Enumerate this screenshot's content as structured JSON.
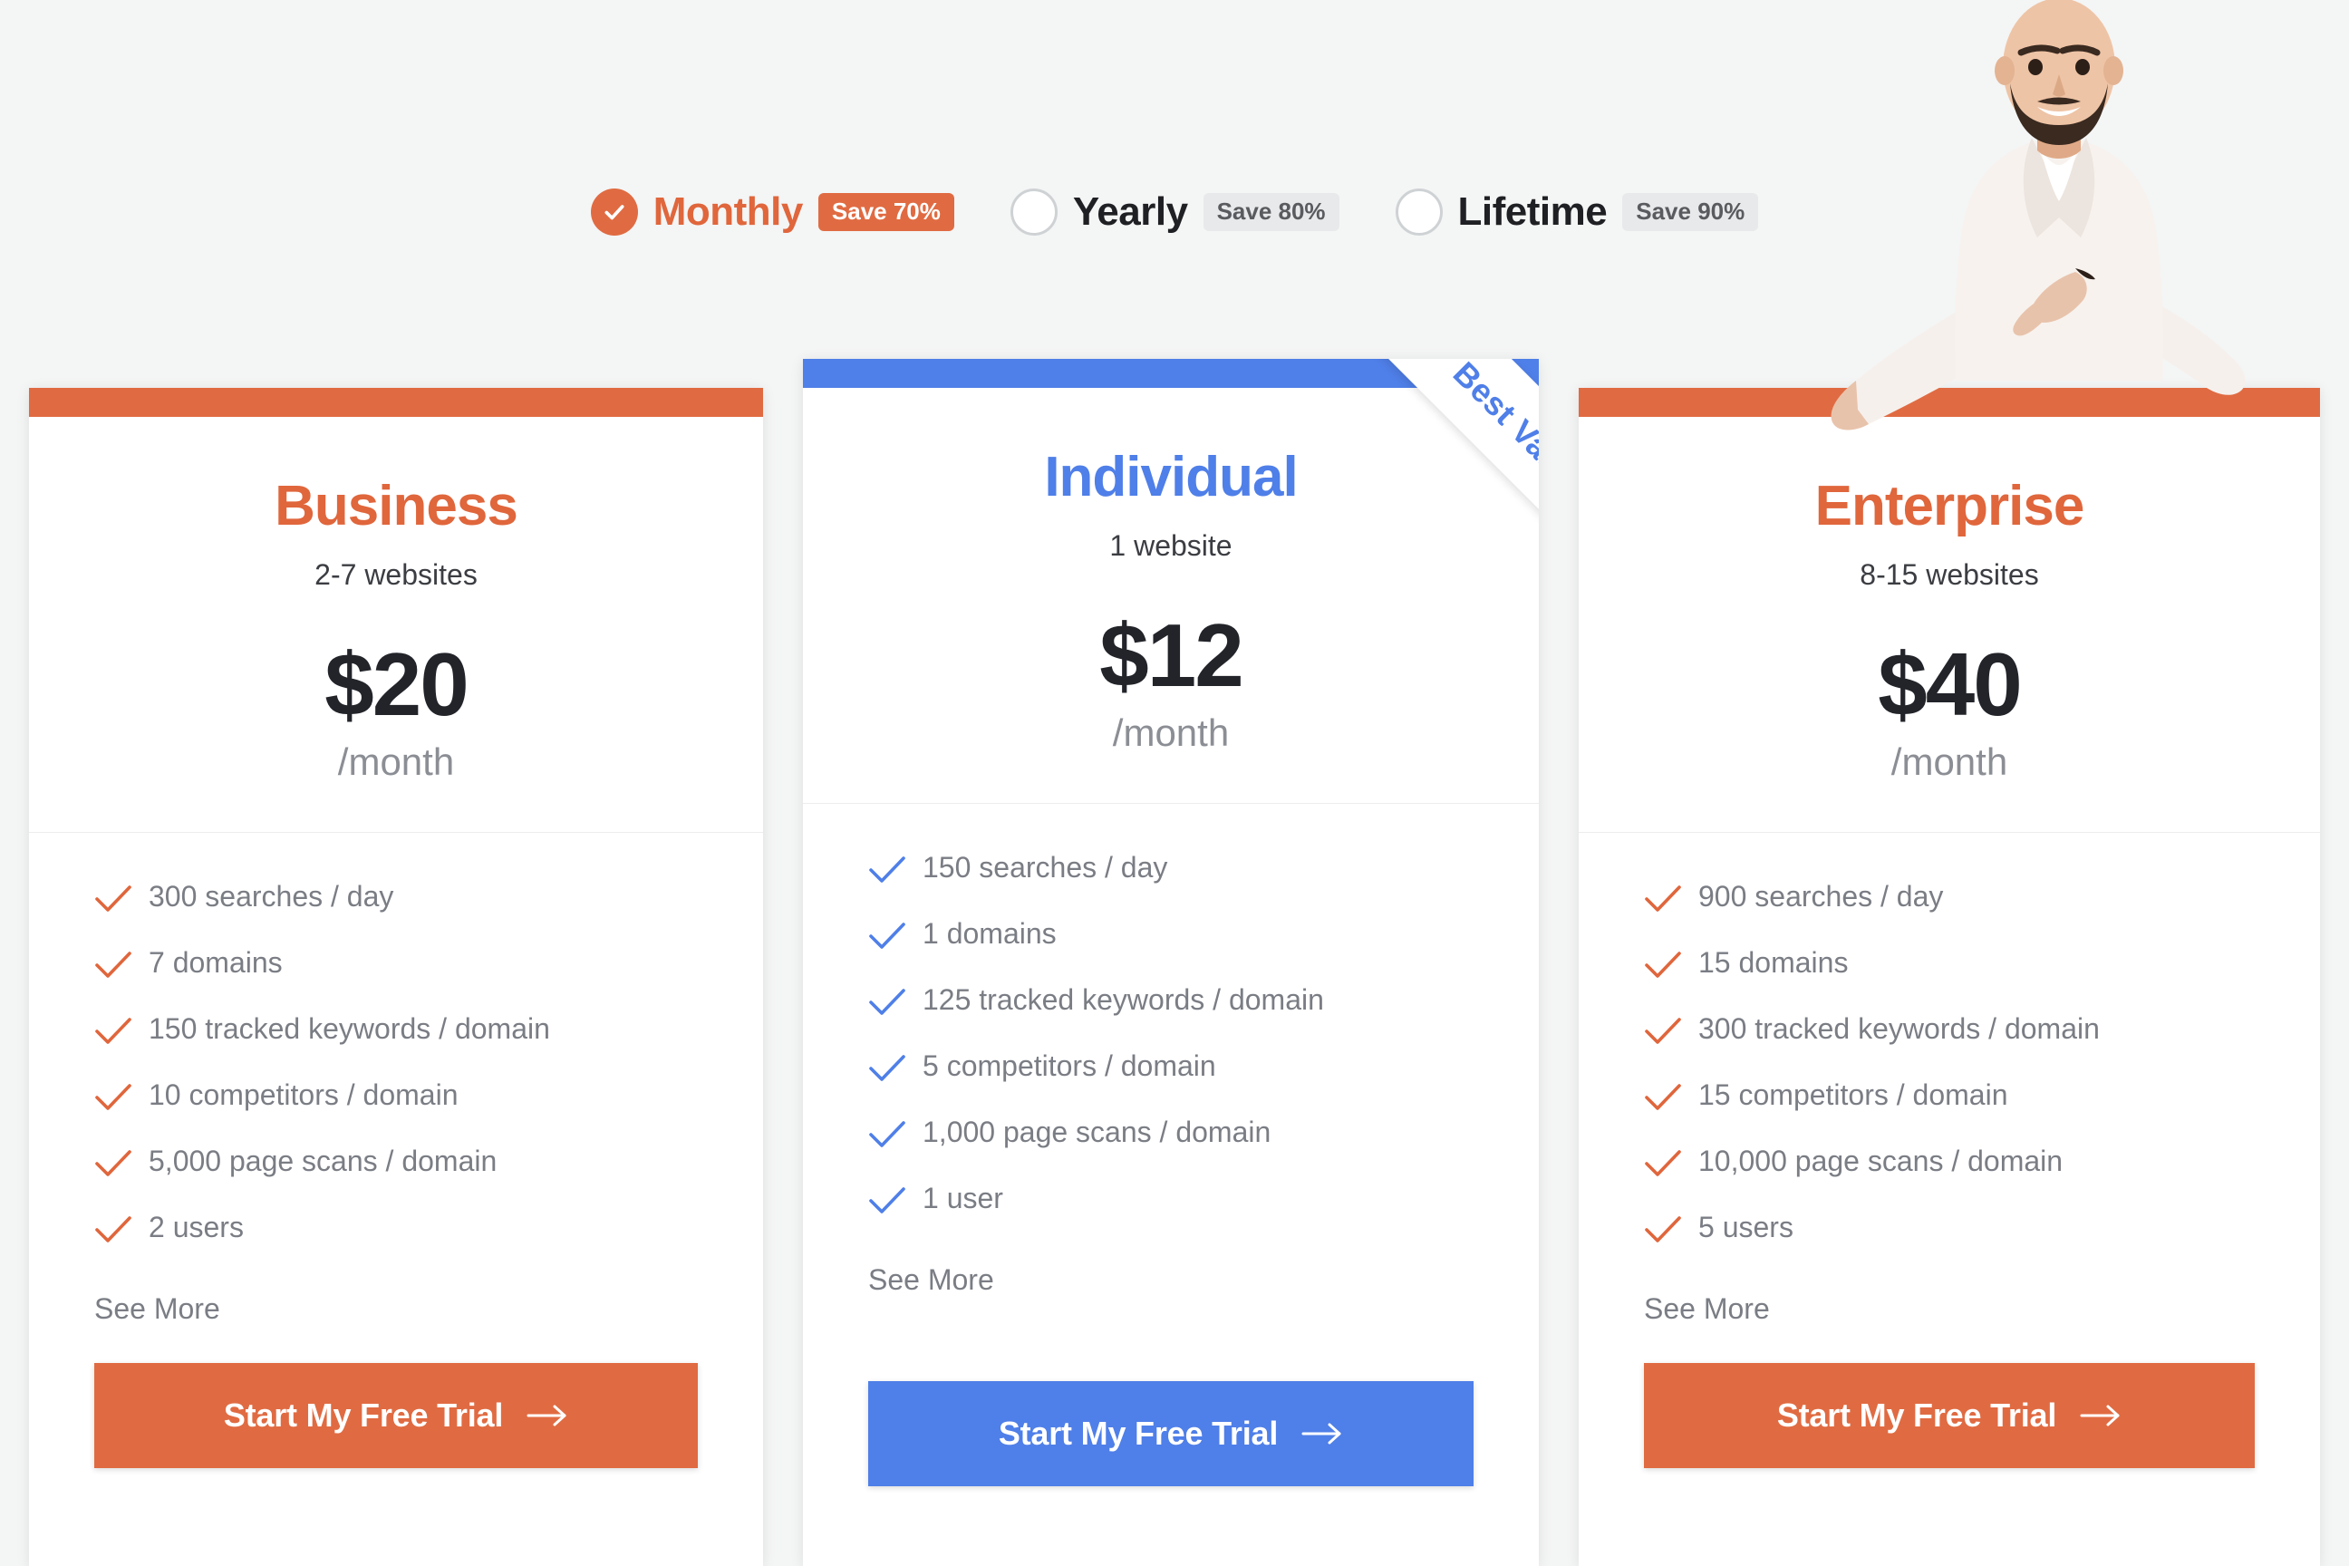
{
  "billing": {
    "options": [
      {
        "label": "Monthly",
        "badge": "Save 70%",
        "selected": true,
        "radio_icon": "radio-checked-icon"
      },
      {
        "label": "Yearly",
        "badge": "Save 80%",
        "selected": false,
        "radio_icon": "radio-empty-icon"
      },
      {
        "label": "Lifetime",
        "badge": "Save 90%",
        "selected": false,
        "radio_icon": "radio-empty-icon"
      }
    ]
  },
  "ribbon": {
    "label": "Best Value"
  },
  "colors": {
    "orange": "#e06b42",
    "orange_text": "#e0663c",
    "blue": "#4f7fe8",
    "page_bg": "#f4f5f5",
    "feature_text": "#7a7d84",
    "price_text": "#22242a",
    "period_text": "#8b8e94",
    "badge_inactive_bg": "#e8e9ea",
    "badge_inactive_text": "#595b5f"
  },
  "plans": [
    {
      "name": "Business",
      "sites": "2-7 websites",
      "price": "$20",
      "period": "/month",
      "accent": "orange",
      "features": [
        "300 searches / day",
        "7 domains",
        "150 tracked keywords / domain",
        "10 competitors / domain",
        "5,000 page scans / domain",
        "2 users"
      ],
      "see_more": "See More",
      "cta": "Start My Free Trial",
      "cta_icon": "arrow-right-icon"
    },
    {
      "name": "Individual",
      "sites": "1 website",
      "price": "$12",
      "period": "/month",
      "accent": "blue",
      "features": [
        "150 searches / day",
        "1 domains",
        "125 tracked keywords / domain",
        "5 competitors / domain",
        "1,000 page scans / domain",
        "1 user"
      ],
      "see_more": "See More",
      "cta": "Start My Free Trial",
      "cta_icon": "arrow-right-icon"
    },
    {
      "name": "Enterprise",
      "sites": "8-15 websites",
      "price": "$40",
      "period": "/month",
      "accent": "orange",
      "features": [
        "900 searches / day",
        "15 domains",
        "300 tracked keywords / domain",
        "15 competitors / domain",
        "10,000 page scans / domain",
        "5 users"
      ],
      "see_more": "See More",
      "cta": "Start My Free Trial",
      "cta_icon": "arrow-right-icon"
    }
  ]
}
